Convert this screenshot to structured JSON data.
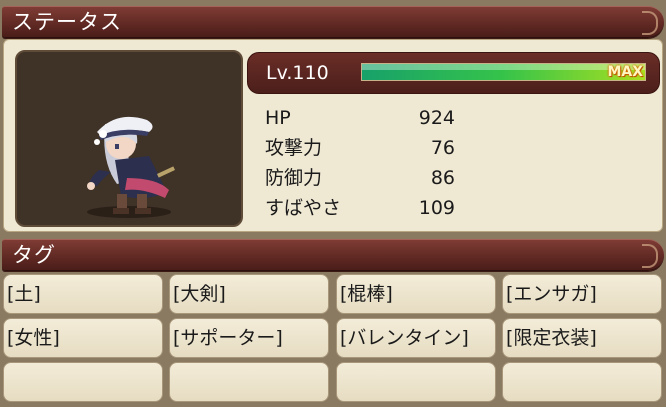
{
  "status_header": {
    "title": "ステータス"
  },
  "level": {
    "label": "Lv.110",
    "max_label": "MAX",
    "exp_fraction": 1.0
  },
  "stats": [
    {
      "name": "HP",
      "value": "924"
    },
    {
      "name": "攻撃力",
      "value": "76"
    },
    {
      "name": "防御力",
      "value": "86"
    },
    {
      "name": "すばやさ",
      "value": "109"
    }
  ],
  "tag_header": {
    "title": "タグ"
  },
  "tags": [
    "[土]",
    "[大剣]",
    "[棍棒]",
    "[エンサガ]",
    "[女性]",
    "[サポーター]",
    "[バレンタイン]",
    "[限定衣装]",
    "",
    "",
    "",
    ""
  ],
  "colors": {
    "banner": "#5a2520",
    "panel": "#efe8d3",
    "exp_bar": "#36c34a",
    "max_text": "#fff7c0"
  }
}
